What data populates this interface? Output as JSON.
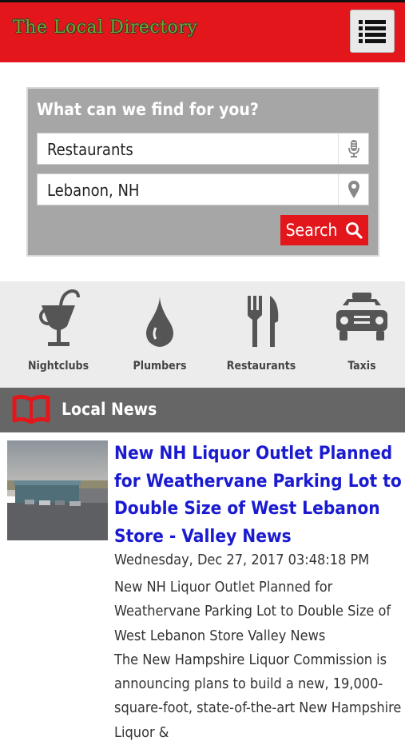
{
  "header": {
    "logo_text": "The Local Directory",
    "menu_icon": "list-menu-icon",
    "background_color": "#e3161b"
  },
  "search": {
    "title": "What can we find for you?",
    "what_value": "Restaurants",
    "what_icon": "microphone-icon",
    "where_value": "Lebanon, NH",
    "where_icon": "location-pin-icon",
    "button_label": "Search",
    "button_icon": "magnifier-icon"
  },
  "categories": [
    {
      "label": "Nightclubs",
      "icon": "cocktail-icon"
    },
    {
      "label": "Plumbers",
      "icon": "water-drop-icon"
    },
    {
      "label": "Restaurants",
      "icon": "fork-knife-icon"
    },
    {
      "label": "Taxis",
      "icon": "taxi-icon"
    }
  ],
  "news": {
    "section_title": "Local News",
    "section_icon": "open-book-icon",
    "article": {
      "headline": "New NH Liquor Outlet Planned for Weathervane Parking Lot to Double Size of West Lebanon Store - Valley News",
      "date": "Wednesday, Dec 27, 2017 03:48:18 PM",
      "summary_1": "New NH Liquor Outlet Planned for Weathervane Parking Lot to Double Size of West Lebanon Store Valley News",
      "summary_2": "The New Hampshire Liquor Commission is announcing plans to build a new, 19,000-square-foot, state-of-the-art New Hampshire Liquor &"
    }
  }
}
